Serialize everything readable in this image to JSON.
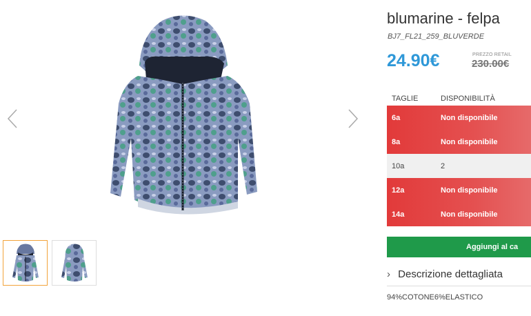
{
  "gallery": {
    "prev_icon": "chevron-left-icon",
    "next_icon": "chevron-right-icon",
    "thumbnails": [
      {
        "view": "front",
        "active": true
      },
      {
        "view": "back",
        "active": false
      }
    ]
  },
  "product": {
    "title": "blumarine - felpa",
    "sku": "BJ7_FL21_259_BLUVERDE",
    "price": "24.90€",
    "retail_label": "PREZZO RETAIL",
    "retail_price": "230.00€"
  },
  "sizes": {
    "header_size": "TAGLIE",
    "header_availability": "DISPONIBILITÀ",
    "rows": [
      {
        "size": "6a",
        "availability": "Non disponibile",
        "available": false
      },
      {
        "size": "8a",
        "availability": "Non disponibile",
        "available": false
      },
      {
        "size": "10a",
        "availability": "2",
        "available": true
      },
      {
        "size": "12a",
        "availability": "Non disponibile",
        "available": false
      },
      {
        "size": "14a",
        "availability": "Non disponibile",
        "available": false
      }
    ]
  },
  "cart": {
    "add_label": "Aggiungi al ca"
  },
  "description": {
    "toggle_label": "Descrizione dettagliata",
    "composition": "94%COTONE6%ELASTICO"
  },
  "colors": {
    "price": "#2f98d8",
    "unavailable": "#e23a3a",
    "button": "#1f9a4a"
  }
}
